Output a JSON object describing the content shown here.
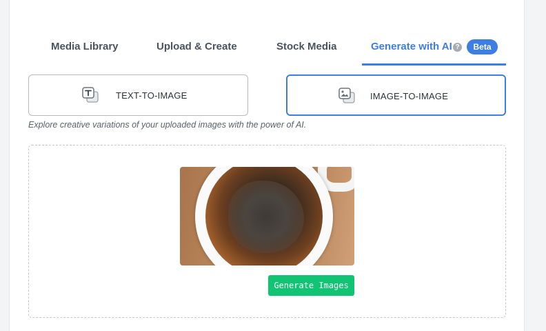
{
  "tabs": [
    {
      "label": "Media Library"
    },
    {
      "label": "Upload & Create"
    },
    {
      "label": "Stock Media"
    },
    {
      "label": "Generate with AI",
      "active": true
    }
  ],
  "help_icon": "question-circle-icon",
  "beta_badge": "Beta",
  "modes": {
    "text_to_image": {
      "label": "TEXT-TO-IMAGE",
      "icon": "text-image-icon",
      "selected": false
    },
    "image_to_image": {
      "label": "IMAGE-TO-IMAGE",
      "icon": "image-copy-icon",
      "selected": true
    }
  },
  "hint": "Explore creative variations of your uploaded images with the power of AI.",
  "upload": {
    "image": "coffee-cup-photo",
    "generate_label": "Generate Images"
  },
  "colors": {
    "accent": "#3d7ee3",
    "generate_button": "#10c474",
    "tab_text": "#4a5360"
  }
}
